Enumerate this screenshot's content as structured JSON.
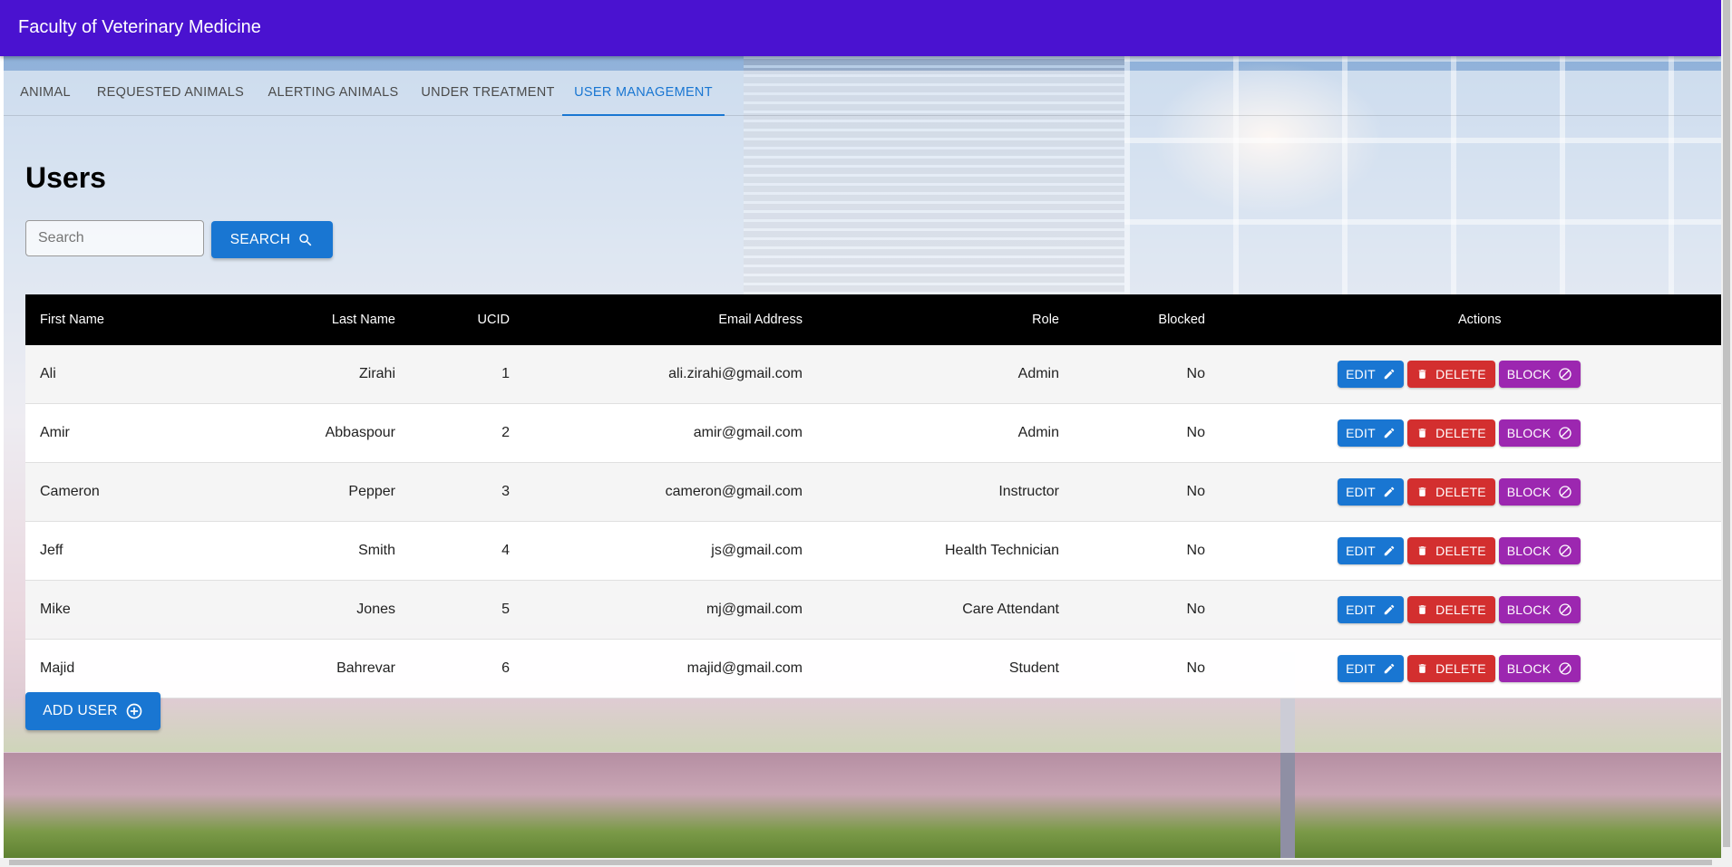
{
  "app": {
    "title": "Faculty of Veterinary Medicine"
  },
  "tabs": [
    {
      "label": "ANIMAL",
      "active": false
    },
    {
      "label": "REQUESTED ANIMALS",
      "active": false
    },
    {
      "label": "ALERTING ANIMALS",
      "active": false
    },
    {
      "label": "UNDER TREATMENT",
      "active": false
    },
    {
      "label": "USER MANAGEMENT",
      "active": true
    }
  ],
  "page": {
    "title": "Users"
  },
  "search": {
    "placeholder": "Search",
    "value": "",
    "button_label": "SEARCH",
    "icon": "search-icon"
  },
  "table": {
    "columns": [
      "First Name",
      "Last Name",
      "UCID",
      "Email Address",
      "Role",
      "Blocked",
      "Actions"
    ],
    "rows": [
      {
        "first": "Ali",
        "last": "Zirahi",
        "ucid": "1",
        "email": "ali.zirahi@gmail.com",
        "role": "Admin",
        "blocked": "No"
      },
      {
        "first": "Amir",
        "last": "Abbaspour",
        "ucid": "2",
        "email": "amir@gmail.com",
        "role": "Admin",
        "blocked": "No"
      },
      {
        "first": "Cameron",
        "last": "Pepper",
        "ucid": "3",
        "email": "cameron@gmail.com",
        "role": "Instructor",
        "blocked": "No"
      },
      {
        "first": "Jeff",
        "last": "Smith",
        "ucid": "4",
        "email": "js@gmail.com",
        "role": "Health Technician",
        "blocked": "No"
      },
      {
        "first": "Mike",
        "last": "Jones",
        "ucid": "5",
        "email": "mj@gmail.com",
        "role": "Care Attendant",
        "blocked": "No"
      },
      {
        "first": "Majid",
        "last": "Bahrevar",
        "ucid": "6",
        "email": "majid@gmail.com",
        "role": "Student",
        "blocked": "No"
      }
    ],
    "actions": {
      "edit": "EDIT",
      "delete": "DELETE",
      "block": "BLOCK"
    }
  },
  "add_user": {
    "label": "ADD USER",
    "icon": "add-circle-icon"
  },
  "colors": {
    "appbar": "#4a12d0",
    "primary": "#1976d2",
    "danger": "#d32f2f",
    "block": "#9c27b0",
    "table_header": "#000000"
  }
}
